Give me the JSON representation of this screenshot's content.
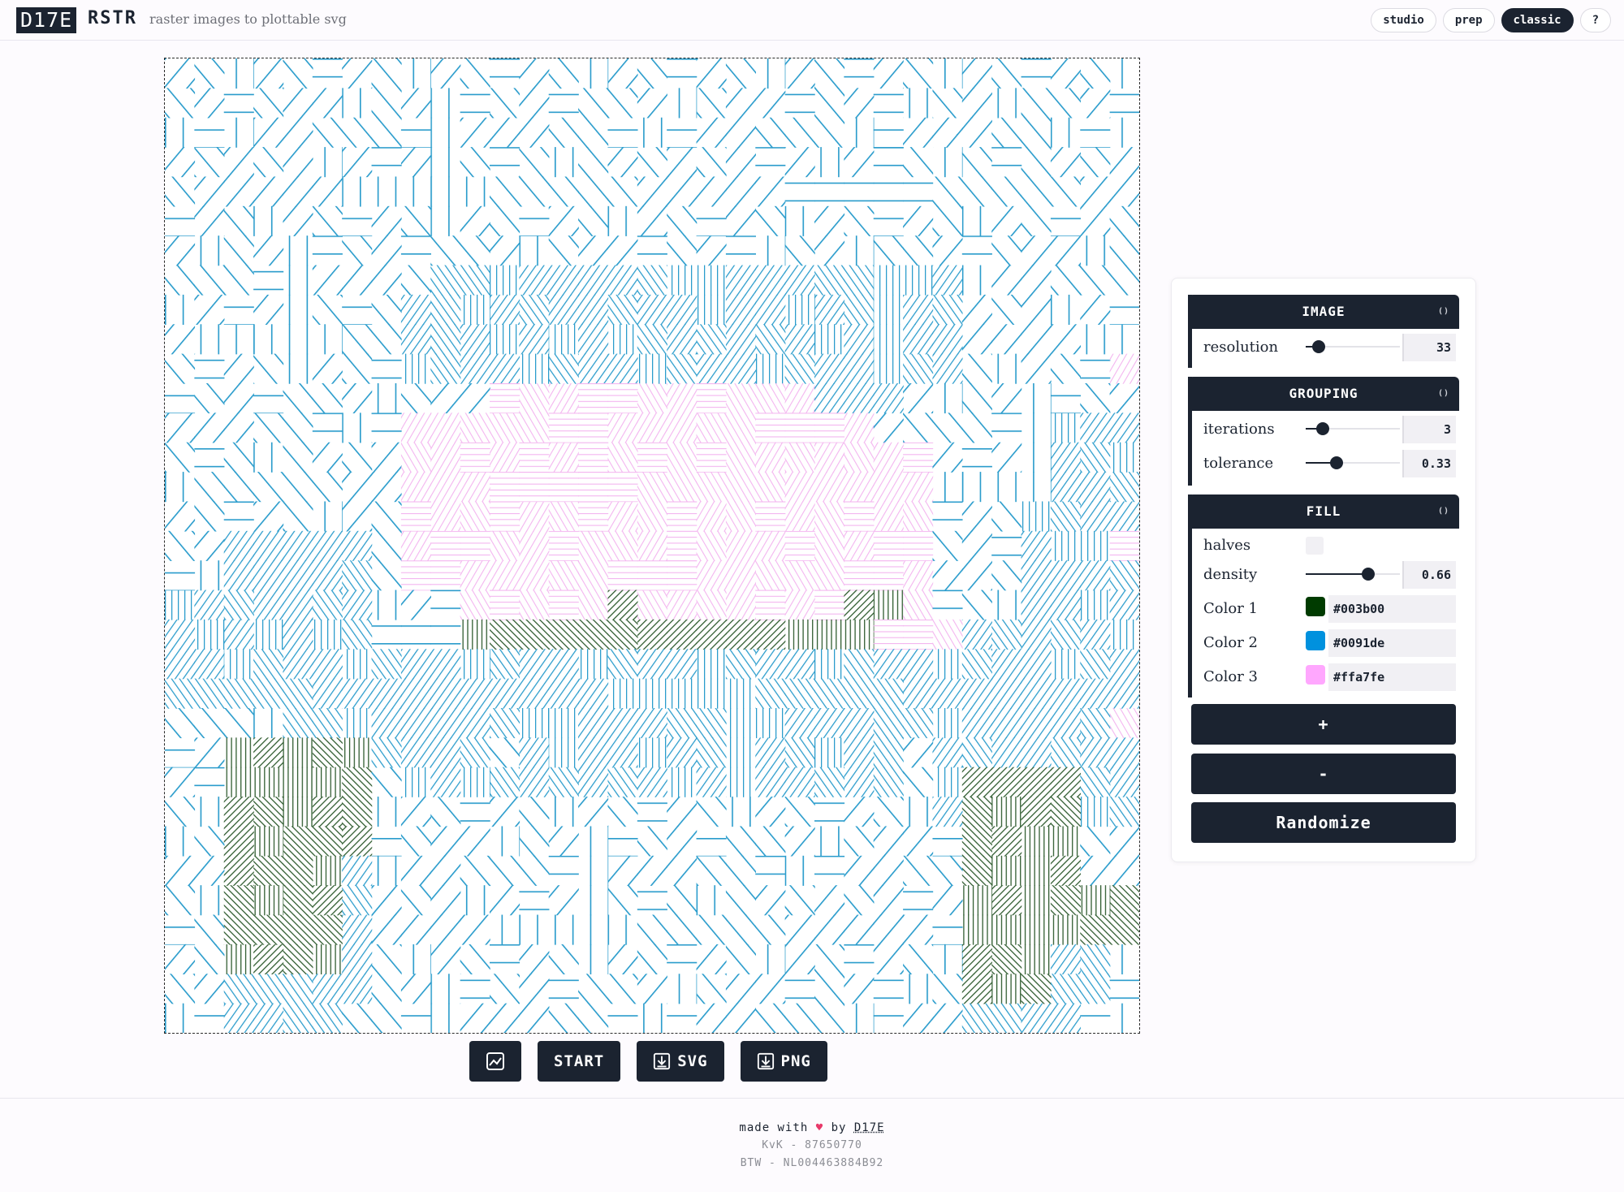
{
  "header": {
    "logo": "D17E",
    "app_name": "RSTR",
    "tagline": "raster images to plottable svg",
    "modes": [
      {
        "label": "studio",
        "active": false
      },
      {
        "label": "prep",
        "active": false
      },
      {
        "label": "classic",
        "active": true
      },
      {
        "label": "?",
        "active": false
      }
    ]
  },
  "toolbar": {
    "image_icon": "image-icon",
    "start_label": "START",
    "svg_label": "SVG",
    "png_label": "PNG",
    "download_icon": "download-icon"
  },
  "panel": {
    "image": {
      "title": "IMAGE",
      "resolution_label": "resolution",
      "resolution_value": "33",
      "resolution_fraction": 0.14
    },
    "grouping": {
      "title": "GROUPING",
      "iterations_label": "iterations",
      "iterations_value": "3",
      "iterations_fraction": 0.18,
      "tolerance_label": "tolerance",
      "tolerance_value": "0.33",
      "tolerance_fraction": 0.33
    },
    "fill": {
      "title": "FILL",
      "halves_label": "halves",
      "halves_checked": false,
      "density_label": "density",
      "density_value": "0.66",
      "density_fraction": 0.66,
      "colors": [
        {
          "label": "Color 1",
          "hex": "#003b00"
        },
        {
          "label": "Color 2",
          "hex": "#0091de"
        },
        {
          "label": "Color 3",
          "hex": "#ffa7fe"
        }
      ]
    },
    "add_label": "+",
    "remove_label": "-",
    "randomize_label": "Randomize"
  },
  "footer": {
    "made_with": "made with",
    "heart": "♥",
    "by": "by",
    "author": "D17E",
    "kvk": "KvK - 87650770",
    "btw": "BTW - NL004463884B92"
  },
  "canvas": {
    "grid_cells": 33,
    "colors": {
      "blue": "#2a9ccc",
      "green": "#2d5a2d",
      "pink": "#f3b4ef"
    }
  }
}
